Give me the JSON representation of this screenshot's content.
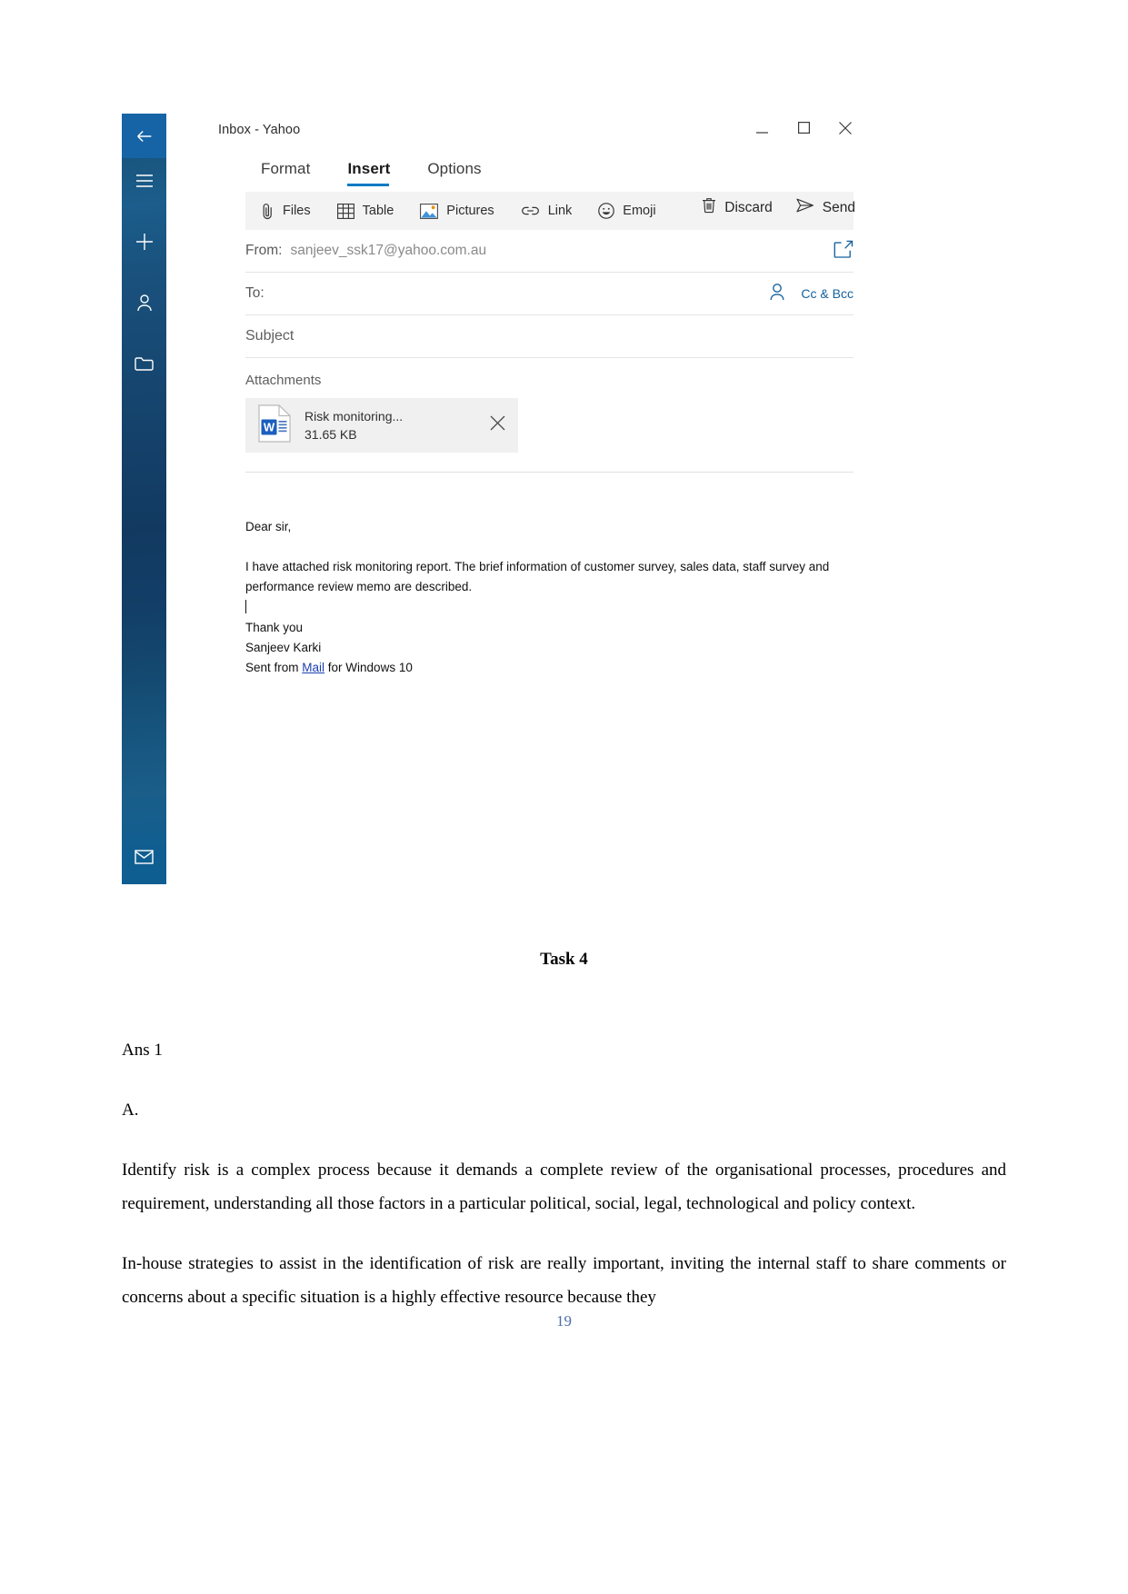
{
  "mail": {
    "window_title": "Inbox - Yahoo",
    "window_controls": {
      "minimize": "minimize-icon",
      "maximize": "maximize-icon",
      "close": "close-icon"
    },
    "rail": {
      "back": "back-arrow-icon",
      "hamburger": "hamburger-menu-icon",
      "new_mail": "plus-icon",
      "people": "person-icon",
      "folders": "folder-icon",
      "mail": "envelope-icon"
    },
    "tabs": [
      {
        "label": "Format",
        "active": false
      },
      {
        "label": "Insert",
        "active": true
      },
      {
        "label": "Options",
        "active": false
      }
    ],
    "actions": [
      {
        "label": "Discard",
        "icon": "trash-icon"
      },
      {
        "label": "Send",
        "icon": "paper-plane-icon"
      }
    ],
    "ribbon": [
      {
        "label": "Files",
        "icon": "paperclip-icon"
      },
      {
        "label": "Table",
        "icon": "table-icon"
      },
      {
        "label": "Pictures",
        "icon": "picture-icon"
      },
      {
        "label": "Link",
        "icon": "link-icon"
      },
      {
        "label": "Emoji",
        "icon": "smiley-icon"
      }
    ],
    "fields": {
      "from_label": "From:",
      "from_value": "sanjeev_ssk17@yahoo.com.au",
      "from_popout_icon": "popout-icon",
      "to_label": "To:",
      "to_value": "",
      "to_people_icon": "person-picker-icon",
      "cc_bcc_label": "Cc & Bcc",
      "subject_placeholder": "Subject"
    },
    "attachments": {
      "title": "Attachments",
      "items": [
        {
          "name": "Risk monitoring...",
          "size": "31.65 KB",
          "file_type_icon": "word-document-icon",
          "remove_icon": "close-icon"
        }
      ]
    },
    "body": {
      "greeting": "Dear sir,",
      "paragraph": "I have attached risk monitoring report. The brief information of customer survey, sales data, staff survey and performance review memo  are described.",
      "closing": "Thank you",
      "sender_name": "Sanjeev Karki",
      "signature_prefix": "Sent from ",
      "signature_link": "Mail",
      "signature_suffix": " for Windows 10"
    }
  },
  "document": {
    "task_heading": "Task 4",
    "ans_label": "Ans 1",
    "sub_label": "A.",
    "paragraph_1": "Identify risk is a complex process because it demands a complete review of the organisational processes, procedures and requirement, understanding all those factors in a particular political, social, legal, technological and policy context.",
    "paragraph_2": "In-house strategies to assist in the identification of risk are really important, inviting the internal staff to share comments or concerns about a specific situation is a highly effective resource because they",
    "page_number": "19"
  },
  "colors": {
    "accent_blue": "#0c7bc4",
    "link_blue": "#15619e",
    "rail_top": "#1664a6",
    "ribbon_bg": "#f3f3f3",
    "attachment_bg": "#f0f0f0",
    "page_number": "#4a6fa8"
  }
}
